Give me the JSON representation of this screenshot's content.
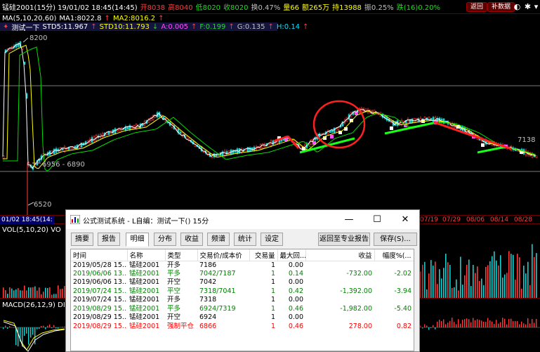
{
  "topbar": {
    "symbol": "锰硅2001(15分) 19/01/02 18:45(14:45)",
    "open": "开8038",
    "high": "高8040",
    "low": "低8020",
    "close": "收8020",
    "change_pct": "换0.47%",
    "volume": "量66",
    "amount": "额265万",
    "position": "持13988",
    "swing": "振0.25%",
    "tie": "跌(16)0.20%",
    "btn1": "返回",
    "btn2": "补数据"
  },
  "ma_line": {
    "params": "MA(5,10,20,60)",
    "ma1": "MA1:8022.8",
    "ma2": "MA2:8016.2"
  },
  "test_line": {
    "label": "测试一下",
    "std5": "STD5:11.967",
    "std10": "STD10:11.793",
    "a": "A:0.005",
    "f": "F:0.199",
    "g": "G:0.135",
    "h": "H:0.14"
  },
  "chart": {
    "price_high": "8200",
    "price_range": "6956 - 6890",
    "price_low": "6520",
    "price_right": "7138"
  },
  "date_axis": {
    "active": "01/02 18:45(14:",
    "d1": "07/19",
    "d2": "07/29",
    "d3": "08/06",
    "d4": "08/14",
    "d5": "08/28"
  },
  "vol_label": "VOL(5,10,20) VO",
  "macd_label": "MACD(26,12,9) DI",
  "dialog": {
    "title": "公式测试系统 - L自编：测试一下() 15分",
    "tabs": [
      "摘要",
      "报告",
      "明细",
      "分布",
      "收益",
      "频谱",
      "统计",
      "设定"
    ],
    "active_tab": "明细",
    "btn_report": "返回至专业报告",
    "btn_save": "保存(S)...",
    "columns": [
      "时间",
      "名称",
      "类型",
      "交易价/成本价",
      "交易量",
      "最大回...",
      "收益",
      "幅度%(..."
    ],
    "rows": [
      {
        "time": "2019/05/28 15...",
        "name": "锰硅2001",
        "type": "开多",
        "price": "7186",
        "qty": "1",
        "maxdd": "0.00",
        "profit": "",
        "pct": "",
        "color": "black"
      },
      {
        "time": "2019/06/06 13...",
        "name": "锰硅2001",
        "type": "平多",
        "price": "7042/7187",
        "qty": "1",
        "maxdd": "0.14",
        "profit": "-732.00",
        "pct": "-2.02",
        "color": "green"
      },
      {
        "time": "2019/06/06 13...",
        "name": "锰硅2001",
        "type": "开空",
        "price": "7042",
        "qty": "1",
        "maxdd": "0.00",
        "profit": "",
        "pct": "",
        "color": "black"
      },
      {
        "time": "2019/07/24 15...",
        "name": "锰硅2001",
        "type": "平空",
        "price": "7318/7041",
        "qty": "1",
        "maxdd": "0.42",
        "profit": "-1,392.00",
        "pct": "-3.94",
        "color": "green"
      },
      {
        "time": "2019/07/24 15...",
        "name": "锰硅2001",
        "type": "开多",
        "price": "7318",
        "qty": "1",
        "maxdd": "0.00",
        "profit": "",
        "pct": "",
        "color": "black"
      },
      {
        "time": "2019/08/29 15...",
        "name": "锰硅2001",
        "type": "平多",
        "price": "6924/7319",
        "qty": "1",
        "maxdd": "0.46",
        "profit": "-1,982.00",
        "pct": "-5.40",
        "color": "green"
      },
      {
        "time": "2019/08/29 15...",
        "name": "锰硅2001",
        "type": "开空",
        "price": "6924",
        "qty": "1",
        "maxdd": "0.00",
        "profit": "",
        "pct": "",
        "color": "black"
      },
      {
        "time": "2019/08/29 15...",
        "name": "锰硅2001",
        "type": "强制平仓",
        "price": "6866",
        "qty": "1",
        "maxdd": "0.46",
        "profit": "278.00",
        "pct": "0.82",
        "color": "red"
      }
    ]
  }
}
